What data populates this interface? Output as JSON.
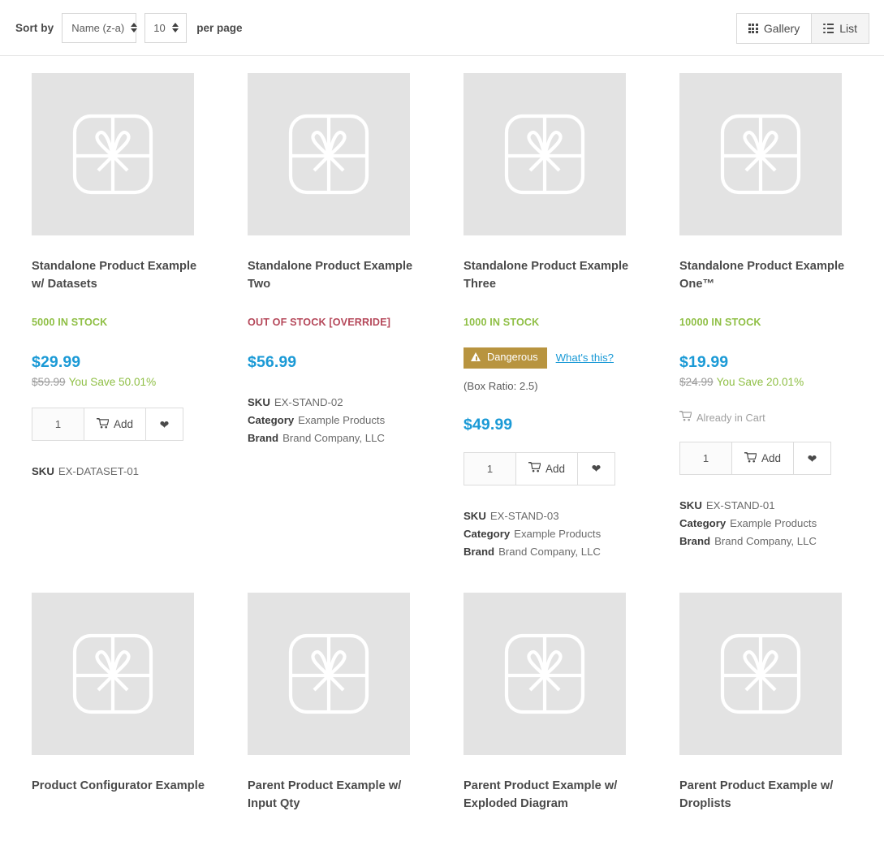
{
  "toolbar": {
    "sort_label": "Sort by",
    "sort_value": "Name (z-a)",
    "per_page_value": "10",
    "per_page_label": "per page",
    "gallery_label": "Gallery",
    "list_label": "List",
    "active_view": "Gallery"
  },
  "colors": {
    "price": "#1b9ad6",
    "in_stock": "#8fbf45",
    "out_of_stock": "#b5485a",
    "save": "#8fbf45",
    "badge": "#b8943f",
    "link": "#1b9ad6",
    "thumb_bg": "#e3e3e3"
  },
  "labels": {
    "add": "Add",
    "sku": "SKU",
    "category": "Category",
    "brand": "Brand",
    "already_in_cart": "Already in Cart",
    "whats_this": "What's this?"
  },
  "products": [
    {
      "title": "Standalone Product Example w/ Datasets",
      "stock": "5000 IN STOCK",
      "stock_state": "in",
      "price": "$29.99",
      "old_price": "$59.99",
      "save": "You Save 50.01%",
      "qty": "1",
      "has_cart": true,
      "already_in_cart": false,
      "badge": null,
      "box_ratio": null,
      "sku": "EX-DATASET-01",
      "category": null,
      "brand": null
    },
    {
      "title": "Standalone Product Example Two",
      "stock": "OUT OF STOCK [OVERRIDE]",
      "stock_state": "out",
      "price": "$56.99",
      "old_price": null,
      "save": null,
      "qty": null,
      "has_cart": false,
      "already_in_cart": false,
      "badge": null,
      "box_ratio": null,
      "sku": "EX-STAND-02",
      "category": "Example Products",
      "brand": "Brand Company, LLC"
    },
    {
      "title": "Standalone Product Example Three",
      "stock": "1000 IN STOCK",
      "stock_state": "in",
      "price": "$49.99",
      "old_price": null,
      "save": null,
      "qty": "1",
      "has_cart": true,
      "already_in_cart": false,
      "badge": "Dangerous",
      "box_ratio": "(Box Ratio: 2.5)",
      "sku": "EX-STAND-03",
      "category": "Example Products",
      "brand": "Brand Company, LLC"
    },
    {
      "title": "Standalone Product Example One™",
      "stock": "10000 IN STOCK",
      "stock_state": "in",
      "price": "$19.99",
      "old_price": "$24.99",
      "save": "You Save 20.01%",
      "qty": "1",
      "has_cart": true,
      "already_in_cart": true,
      "badge": null,
      "box_ratio": null,
      "sku": "EX-STAND-01",
      "category": "Example Products",
      "brand": "Brand Company, LLC"
    }
  ],
  "products_row2": [
    {
      "title": "Product Configurator Example"
    },
    {
      "title": "Parent Product Example w/ Input Qty"
    },
    {
      "title": "Parent Product Example w/ Exploded Diagram"
    },
    {
      "title": "Parent Product Example w/ Droplists"
    }
  ]
}
